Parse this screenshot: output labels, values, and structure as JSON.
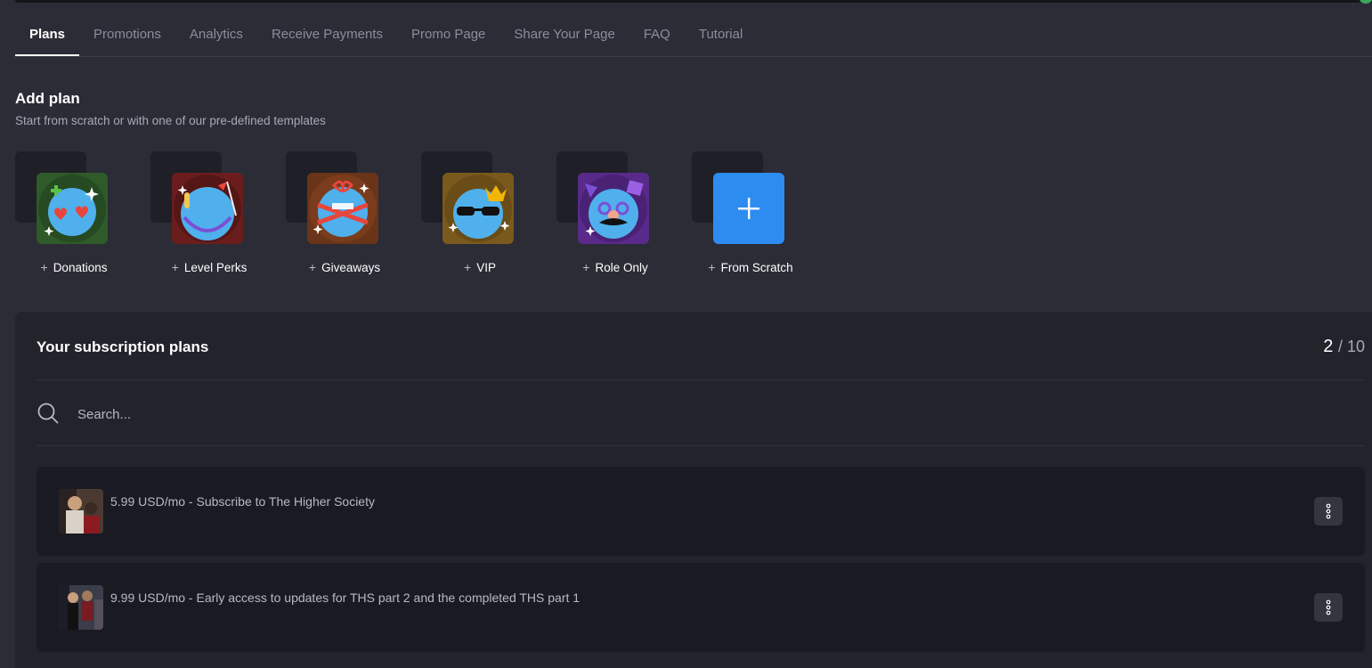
{
  "tabs": [
    {
      "label": "Plans",
      "active": true
    },
    {
      "label": "Promotions"
    },
    {
      "label": "Analytics"
    },
    {
      "label": "Receive Payments"
    },
    {
      "label": "Promo Page"
    },
    {
      "label": "Share Your Page"
    },
    {
      "label": "FAQ"
    },
    {
      "label": "Tutorial"
    }
  ],
  "add_plan": {
    "title": "Add plan",
    "subtitle": "Start from scratch or with one of our pre-defined templates",
    "templates": [
      {
        "label": "Donations",
        "icon": "donations-blob-icon",
        "bg": "#2f5a2a"
      },
      {
        "label": "Level Perks",
        "icon": "level-perks-blob-icon",
        "bg": "#6b1d1d"
      },
      {
        "label": "Giveaways",
        "icon": "giveaways-blob-icon",
        "bg": "#6a3418"
      },
      {
        "label": "VIP",
        "icon": "vip-blob-icon",
        "bg": "#7a5a1c"
      },
      {
        "label": "Role Only",
        "icon": "role-only-blob-icon",
        "bg": "#5a2a8a"
      },
      {
        "label": "From Scratch",
        "icon": "plus-icon",
        "bg": "#2d8cf0"
      }
    ]
  },
  "subscriptions": {
    "title": "Your subscription plans",
    "count": "2",
    "max": "/ 10",
    "search_placeholder": "Search...",
    "plans": [
      {
        "text": "5.99 USD/mo - Subscribe to The Higher Society"
      },
      {
        "text": "9.99 USD/mo - Early access to updates for THS part 2 and the completed THS part 1"
      }
    ]
  },
  "colors": {
    "background": "#2b2c36",
    "panel": "#22232b",
    "row": "#1a1b22",
    "accent": "#2d8cf0"
  }
}
